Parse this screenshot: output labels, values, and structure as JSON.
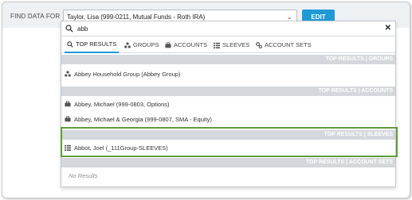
{
  "header": {
    "find_label": "FIND DATA FOR",
    "selected_account": "Taylor, Lisa (999-0211, Mutual Funds - Roth IRA)",
    "edit_label": "EDIT"
  },
  "search": {
    "value": "abb",
    "placeholder": ""
  },
  "tabs": [
    {
      "label": "TOP RESULTS",
      "icon": "search-icon"
    },
    {
      "label": "GROUPS",
      "icon": "groups-icon"
    },
    {
      "label": "ACCOUNTS",
      "icon": "briefcase-icon"
    },
    {
      "label": "SLEEVES",
      "icon": "sleeves-icon"
    },
    {
      "label": "ACCOUNT SETS",
      "icon": "gears-icon"
    }
  ],
  "sections": {
    "groups": {
      "title": "TOP RESULTS | GROUPS",
      "items": [
        "Abbey Household Group (Abbey Group)"
      ]
    },
    "accounts": {
      "title": "TOP RESULTS | ACCOUNTS",
      "items": [
        "Abbey, Michael (999-0803, Options)",
        "Abbey, Michael & Georgia (999-0807, SMA - Equity)"
      ]
    },
    "sleeves": {
      "title": "TOP RESULTS | SLEEVES",
      "items": [
        "Abbot, Joel (_111Group-SLEEVES)"
      ]
    },
    "account_sets": {
      "title": "TOP RESULTS | ACCOUNT SETS",
      "empty_text": "No Results"
    }
  },
  "colors": {
    "accent": "#1f9ad6",
    "highlight": "#5f9c3a",
    "section_bg": "#d4d7db"
  }
}
